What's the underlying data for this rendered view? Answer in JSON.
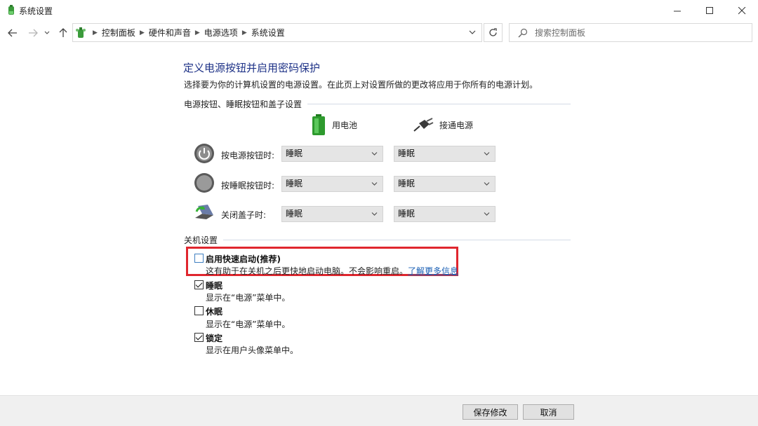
{
  "window": {
    "title": "系统设置",
    "controls": [
      "minimize-icon",
      "maximize-icon",
      "close-icon"
    ]
  },
  "navigation": {
    "breadcrumb": [
      "控制面板",
      "硬件和声音",
      "电源选项",
      "系统设置"
    ],
    "search_placeholder": "搜索控制面板"
  },
  "page": {
    "title": "定义电源按钮并启用密码保护",
    "description": "选择要为你的计算机设置的电源设置。在此页上对设置所做的更改将应用于你所有的电源计划。"
  },
  "power_buttons": {
    "section_label": "电源按钮、睡眠按钮和盖子设置",
    "columns": [
      {
        "label": "用电池",
        "icon": "battery-icon"
      },
      {
        "label": "接通电源",
        "icon": "power-plug-icon"
      }
    ],
    "rows": [
      {
        "label": "按电源按钮时:",
        "icon": "power-button-icon",
        "battery": "睡眠",
        "plugged": "睡眠"
      },
      {
        "label": "按睡眠按钮时:",
        "icon": "sleep-button-icon",
        "battery": "睡眠",
        "plugged": "睡眠"
      },
      {
        "label": "关闭盖子时:",
        "icon": "laptop-lid-icon",
        "battery": "睡眠",
        "plugged": "睡眠"
      }
    ]
  },
  "shutdown": {
    "section_label": "关机设置",
    "options": [
      {
        "title": "启用快速启动(推荐)",
        "description": "这有助于在关机之后更快地启动电脑。不会影响重启。",
        "link": "了解更多信息",
        "checked": false
      },
      {
        "title": "睡眠",
        "description": "显示在“电源”菜单中。",
        "checked": true
      },
      {
        "title": "休眠",
        "description": "显示在“电源”菜单中。",
        "checked": false
      },
      {
        "title": "锁定",
        "description": "显示在用户头像菜单中。",
        "checked": true
      }
    ]
  },
  "footer": {
    "save_label": "保存修改",
    "cancel_label": "取消"
  },
  "colors": {
    "title_blue": "#1e3287",
    "link_blue": "#1a5fb4",
    "highlight_red": "#e0262e"
  }
}
